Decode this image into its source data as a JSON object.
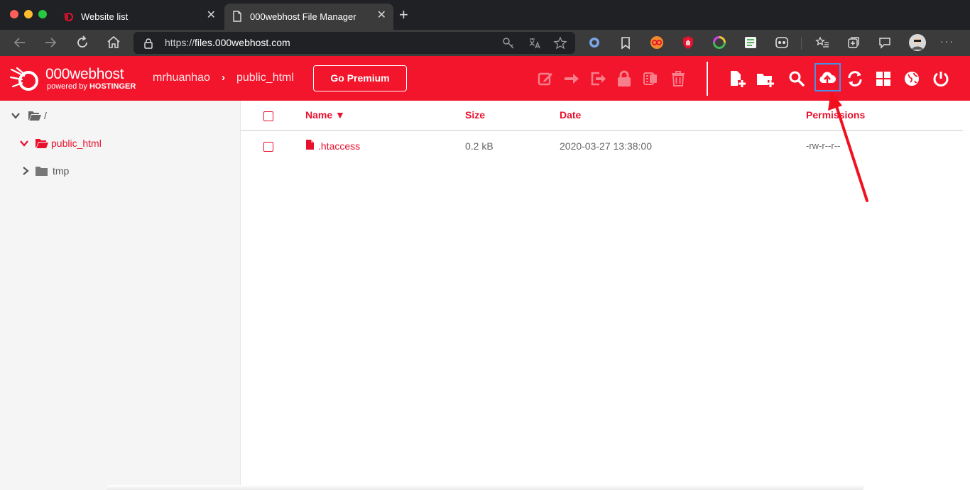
{
  "browser": {
    "tabs": [
      {
        "title": "Website list",
        "favicon": "000webhost-logo-icon",
        "active": false
      },
      {
        "title": "000webhost File Manager",
        "favicon": "page-icon",
        "active": true
      }
    ],
    "close_glyph": "✕",
    "new_tab_glyph": "+",
    "address": {
      "protocol": "https://",
      "host": "files.000webhost.com"
    },
    "more_glyph": "···"
  },
  "app": {
    "brand": {
      "name": "000webhost",
      "tagline_prefix": "powered by",
      "tagline_brand": "HOSTINGER"
    },
    "breadcrumb": {
      "user": "mrhuanhao",
      "separator": "›",
      "folder": "public_html"
    },
    "premium_label": "Go Premium",
    "accent_color": "#f2152c",
    "highlight_color": "#4e8fe6"
  },
  "sidebar": {
    "root": {
      "label": "/"
    },
    "items": [
      {
        "label": "public_html",
        "state": "expanded",
        "active": true
      },
      {
        "label": "tmp",
        "state": "collapsed",
        "active": false
      }
    ]
  },
  "table": {
    "columns": {
      "name": "Name ▼",
      "size": "Size",
      "date": "Date",
      "permissions": "Permissions"
    },
    "rows": [
      {
        "name": ".htaccess",
        "size": "0.2 kB",
        "date": "2020-03-27 13:38:00",
        "permissions": "-rw-r--r--"
      }
    ]
  }
}
